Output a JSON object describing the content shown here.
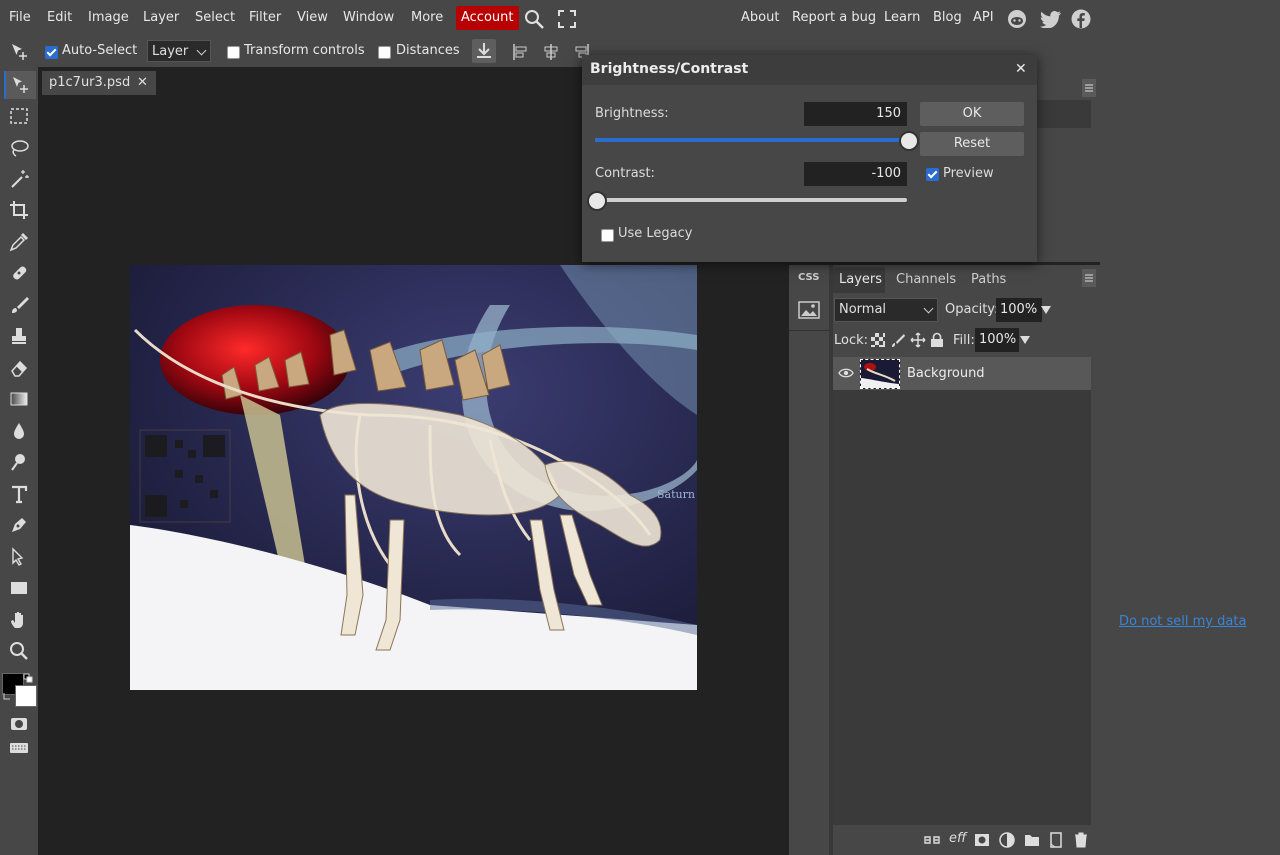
{
  "menubar": {
    "items": [
      "File",
      "Edit",
      "Image",
      "Layer",
      "Select",
      "Filter",
      "View",
      "Window",
      "More"
    ],
    "account": "Account",
    "right_links": [
      "About",
      "Report a bug",
      "Learn",
      "Blog",
      "API"
    ],
    "social_icons": [
      "reddit-icon",
      "twitter-icon",
      "facebook-icon"
    ]
  },
  "options": {
    "auto_select_label": "Auto-Select",
    "auto_select_checked": true,
    "layer_select_value": "Layer",
    "transform_controls_label": "Transform controls",
    "distances_label": "Distances"
  },
  "document": {
    "tab_name": "p1c7ur3.psd",
    "close_glyph": "✕"
  },
  "dialog": {
    "title": "Brightness/Contrast",
    "close_glyph": "✕",
    "brightness_label": "Brightness:",
    "brightness_value": "150",
    "brightness_fraction": 1.0,
    "contrast_label": "Contrast:",
    "contrast_value": "-100",
    "contrast_fraction": 0.0,
    "use_legacy_label": "Use Legacy",
    "use_legacy_checked": false,
    "ok_label": "OK",
    "reset_label": "Reset",
    "preview_label": "Preview",
    "preview_checked": true
  },
  "side_strip": {
    "css_label": "CSS"
  },
  "layers_panel": {
    "tabs": [
      "Layers",
      "Channels",
      "Paths"
    ],
    "active_tab": "Layers",
    "blend_mode": "Normal",
    "opacity_label": "Opacity:",
    "opacity_value": "100%",
    "lock_label": "Lock:",
    "fill_label": "Fill:",
    "fill_value": "100%",
    "layers": [
      {
        "name": "Background",
        "visible": true
      }
    ],
    "footer_eff_label": "eff"
  },
  "canvas_text": {
    "saturn_label": "Saturn"
  },
  "footer_link": "Do not sell my data",
  "colors": {
    "accent": "#2b6cd0",
    "account_bg": "#b80000",
    "panel_bg": "#474747",
    "workspace_bg": "#222222",
    "link": "#3b84d6"
  }
}
